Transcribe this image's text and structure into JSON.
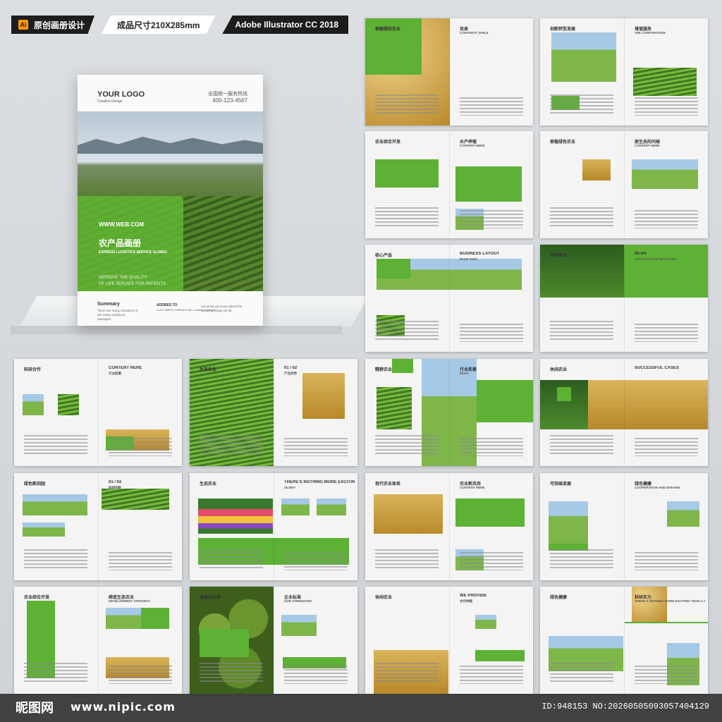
{
  "topbar": {
    "app_badge": "Ai",
    "label_1": "原创画册设计",
    "label_2": "成品尺寸210X285mm",
    "label_3": "Adobe Illustrator CC 2018"
  },
  "cover": {
    "logo": "YOUR LOGO",
    "logo_sub": "Creative Design",
    "hotline_label": "全国统一服务热线",
    "hotline_number": "400-123-4567",
    "website": "WWW.WEB.COM",
    "title": "农产品画册",
    "subtitle": "EXPRESS LOGISTICS SERVICE GLOBAL",
    "tagline_1": "IMPROVE THE QUALITY",
    "tagline_2": "OF LIFE SERVICE FOR PATIENTS",
    "summary_title": "Summary",
    "summary_text": "There are many variations of are many variations passages.",
    "address_title": "ADDRES TO",
    "address_text": "CUSTOMER COMPANY 8th Location, Country",
    "let_text": "Let us let you more about the amazing things we do."
  },
  "spreads": [
    {
      "title": "根植绿色农业",
      "title2": "目录",
      "sub": "CONTENTS TABLE"
    },
    {
      "title": "创新转型发展",
      "title2": "增值服务",
      "sub": "THE CORPORATION"
    },
    {
      "title": "农业综合开发",
      "title2": "水产养殖",
      "sub": "CONTENT HERE"
    },
    {
      "title": "根植绿色农业",
      "title2": "原生态的问候",
      "sub": "CONTENT HERE"
    },
    {
      "title": "核心产品",
      "title2": "BUSINESS LAYOUT",
      "sub": "PAGE 01/02"
    },
    {
      "title": "特色农业",
      "title2": "98.5%",
      "sub": "ALWAYS MAKE AN EFFORT"
    },
    {
      "title": "科研合作",
      "title2": "CONTENT HERE",
      "sub": "行业前景"
    },
    {
      "title": "生态农业",
      "title2": "01 / 02",
      "sub": "产品优势"
    },
    {
      "title": "精耕农业",
      "title2": "行业前景",
      "sub": "98.5%"
    },
    {
      "title": "休闲农业",
      "title2": "SUCCESSFUL CASES",
      "sub": ""
    },
    {
      "title": "绿色新田园",
      "title2": "01 / 02",
      "sub": "科研创新"
    },
    {
      "title": "生态农业",
      "title2": "THERE'S NOTHING MORE EXCITING THAN A GOOD IDEA",
      "sub": "30,000+"
    },
    {
      "title": "现代农业体系",
      "title2": "农业新风尚",
      "sub": "CONTENT HERE"
    },
    {
      "title": "可持续发展",
      "title2": "绿色健康",
      "sub": "COOPERATION AND WIN-WIN"
    },
    {
      "title": "农业综合开发",
      "title2": "缔造生态农业",
      "sub": "DEVELOPMENT STRATEGY"
    },
    {
      "title": "健康纯天然",
      "title2": "企业标准",
      "sub": "OUR STRENGTHS"
    },
    {
      "title": "休闲农业",
      "title2": "WE PROVIDE",
      "sub": "合作种植"
    },
    {
      "title": "绿色健康",
      "title2": "科研实力",
      "sub": "THERE'S NOTHING MORE EXCITING THAN A GOOD IDEA"
    }
  ],
  "watermark": {
    "site_cn": "昵图网",
    "site_url": "www.nipic.com",
    "id_text": "ID:948153 NO:20260505093057404129"
  }
}
